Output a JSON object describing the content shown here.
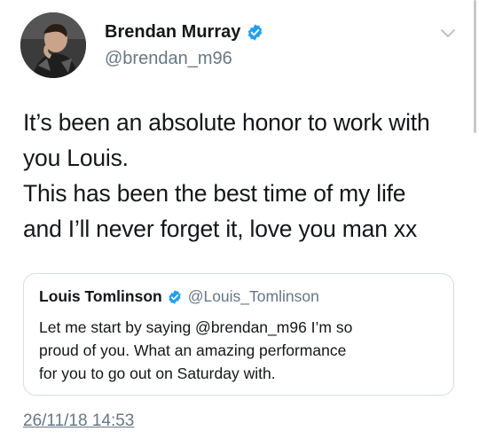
{
  "author": {
    "display_name": "Brendan Murray",
    "handle": "@brendan_m96",
    "verified": true,
    "avatar_icon": "profile-photo"
  },
  "menu_icon": "chevron-down-icon",
  "tweet": {
    "lines": [
      "It’s been an absolute honor to work with",
      "you Louis.",
      "This has been the best time of my life",
      "and I’ll never forget it, love you man xx"
    ],
    "timestamp": "26/11/18 14:53"
  },
  "quoted_tweet": {
    "display_name": "Louis Tomlinson",
    "handle": "@Louis_Tomlinson",
    "verified": true,
    "lines": [
      "Let me start by saying @brendan_m96 I’m so",
      "proud of you. What an amazing performance",
      "for you to go out on Saturday with."
    ]
  },
  "colors": {
    "verified_blue": "#1da1f2",
    "secondary_text": "#657786",
    "primary_text": "#14171a",
    "border": "#d6dde3"
  }
}
